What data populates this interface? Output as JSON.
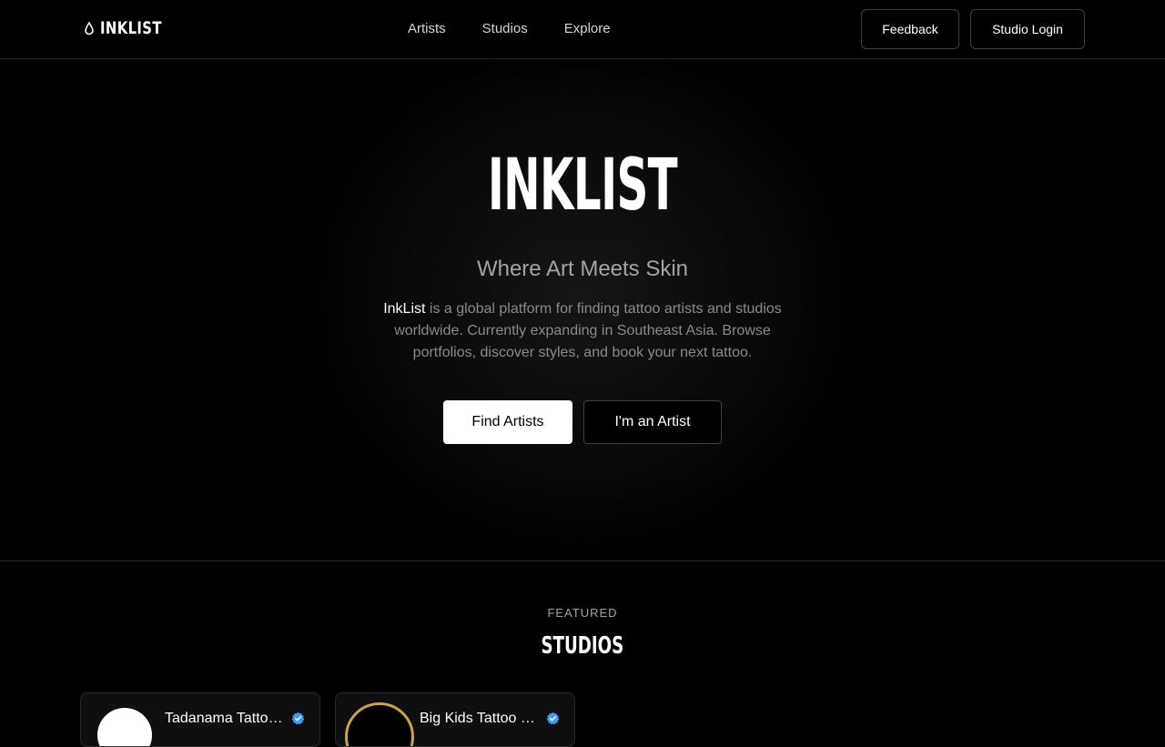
{
  "nav": {
    "brand": "INKLIST",
    "links": [
      "Artists",
      "Studios",
      "Explore"
    ],
    "feedback_label": "Feedback",
    "login_label": "Studio Login"
  },
  "hero": {
    "title": "INKLIST",
    "subtitle": "Where Art Meets Skin",
    "description_brand": "InkList",
    "description_rest": " is a global platform for finding tattoo artists and studios worldwide. Currently expanding in Southeast Asia. Browse portfolios, discover styles, and book your next tattoo.",
    "primary_cta": "Find Artists",
    "secondary_cta": "I'm an Artist"
  },
  "featured": {
    "label": "FEATURED",
    "title": "STUDIOS",
    "studios": [
      {
        "name": "Tadanama Tattoo Studio",
        "verified": true
      },
      {
        "name": "Big Kids Tattoo Studio",
        "verified": true
      }
    ]
  },
  "colors": {
    "background": "#000000",
    "verified_badge": "#3b9bf5",
    "avatar_ring": "#c9a24a"
  },
  "icons": {
    "logo": "ink-drop-icon",
    "verified": "verified-badge-icon"
  }
}
